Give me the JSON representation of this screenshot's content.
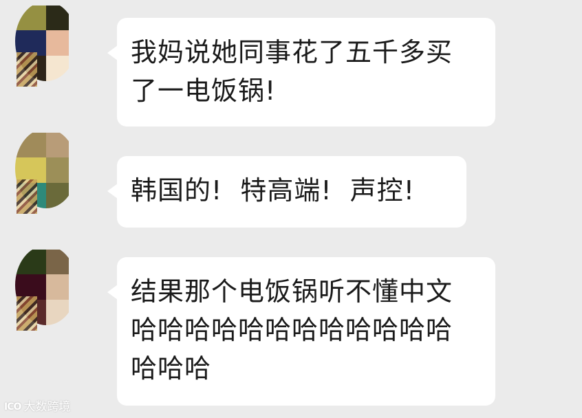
{
  "colors": {
    "background": "#ebebeb",
    "bubble": "#ffffff",
    "text": "#1a1a1a"
  },
  "messages": [
    {
      "sender": "other",
      "text": "我妈说她同事花了五千多买\n了一电饭锅!",
      "avatar": {
        "icon": "mosaic-avatar-icon",
        "tiles": [
          "#959042",
          "#2b2a18",
          "#1f2a5a",
          "#e7b99c",
          "#2e2418",
          "#f5e6d0"
        ]
      }
    },
    {
      "sender": "other",
      "text": "韩国的!  特高端!  声控!",
      "avatar": {
        "icon": "mosaic-avatar-icon",
        "tiles": [
          "#a08b5a",
          "#b89c78",
          "#d6c65a",
          "#9c8f58",
          "#2e8a7a",
          "#6a6a3a"
        ]
      }
    },
    {
      "sender": "other",
      "text": "结果那个电饭锅听不懂中文\n哈哈哈哈哈哈哈哈哈哈哈哈\n哈哈哈",
      "avatar": {
        "icon": "mosaic-avatar-icon",
        "tiles": [
          "#2a3a18",
          "#7a6548",
          "#3a0c1c",
          "#d7b99c",
          "#5a2a2a",
          "#e8d6c0"
        ]
      }
    }
  ],
  "watermark": {
    "logo": "ICO",
    "text": "大数跨境"
  }
}
